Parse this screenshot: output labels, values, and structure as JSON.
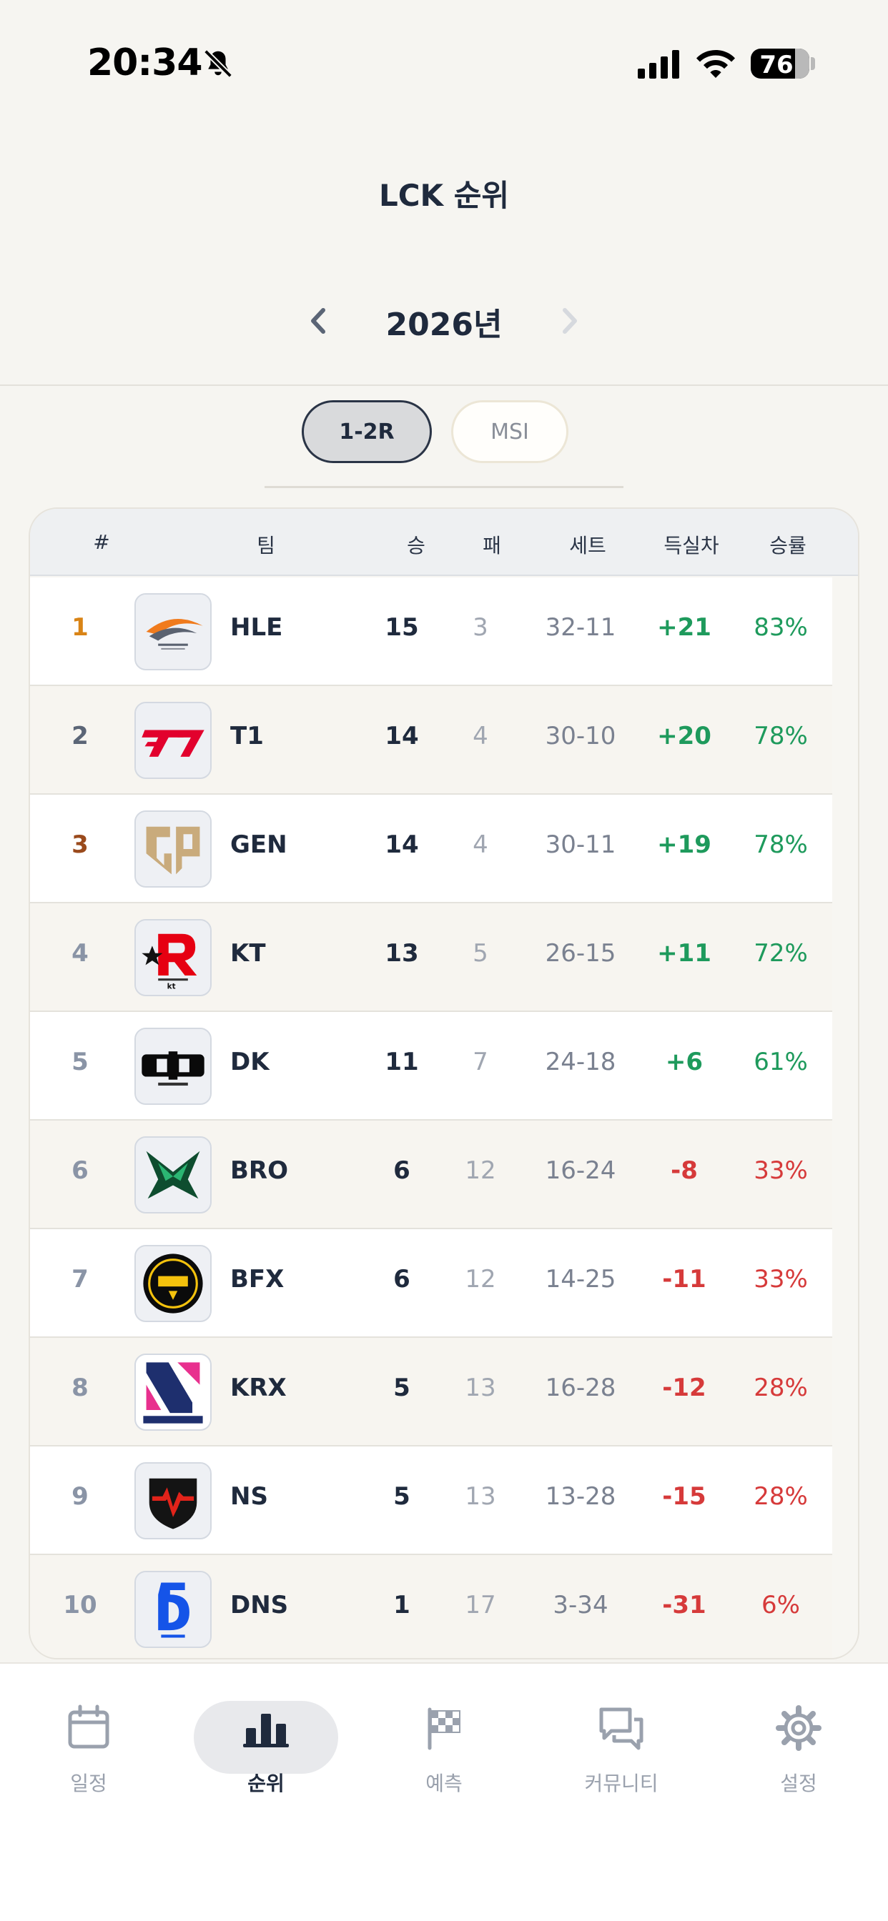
{
  "status_bar": {
    "time": "20:34",
    "battery": "76"
  },
  "header": {
    "title": "LCK 순위",
    "year": "2026년"
  },
  "segments": {
    "active": "1-2R",
    "inactive": "MSI"
  },
  "table": {
    "headers": {
      "rank": "#",
      "team": "팀",
      "win": "승",
      "loss": "패",
      "set": "세트",
      "diff": "득실차",
      "rate": "승률"
    },
    "rows": [
      {
        "rank": "1",
        "team": "HLE",
        "win": "15",
        "loss": "3",
        "set": "32-11",
        "diff": "+21",
        "rate": "83%",
        "rank_color": "#d98416",
        "logo": "hle-logo-icon"
      },
      {
        "rank": "2",
        "team": "T1",
        "win": "14",
        "loss": "4",
        "set": "30-10",
        "diff": "+20",
        "rate": "78%",
        "rank_color": "#5b6576",
        "logo": "t1-logo-icon"
      },
      {
        "rank": "3",
        "team": "GEN",
        "win": "14",
        "loss": "4",
        "set": "30-11",
        "diff": "+19",
        "rate": "78%",
        "rank_color": "#9a4a1c",
        "logo": "gen-logo-icon"
      },
      {
        "rank": "4",
        "team": "KT",
        "win": "13",
        "loss": "5",
        "set": "26-15",
        "diff": "+11",
        "rate": "72%",
        "rank_color": "#8a94a6",
        "logo": "kt-logo-icon"
      },
      {
        "rank": "5",
        "team": "DK",
        "win": "11",
        "loss": "7",
        "set": "24-18",
        "diff": "+6",
        "rate": "61%",
        "rank_color": "#8a94a6",
        "logo": "dk-logo-icon"
      },
      {
        "rank": "6",
        "team": "BRO",
        "win": "6",
        "loss": "12",
        "set": "16-24",
        "diff": "-8",
        "rate": "33%",
        "rank_color": "#8a94a6",
        "logo": "bro-logo-icon"
      },
      {
        "rank": "7",
        "team": "BFX",
        "win": "6",
        "loss": "12",
        "set": "14-25",
        "diff": "-11",
        "rate": "33%",
        "rank_color": "#8a94a6",
        "logo": "bfx-logo-icon"
      },
      {
        "rank": "8",
        "team": "KRX",
        "win": "5",
        "loss": "13",
        "set": "16-28",
        "diff": "-12",
        "rate": "28%",
        "rank_color": "#8a94a6",
        "logo": "krx-logo-icon"
      },
      {
        "rank": "9",
        "team": "NS",
        "win": "5",
        "loss": "13",
        "set": "13-28",
        "diff": "-15",
        "rate": "28%",
        "rank_color": "#8a94a6",
        "logo": "ns-logo-icon"
      },
      {
        "rank": "10",
        "team": "DNS",
        "win": "1",
        "loss": "17",
        "set": "3-34",
        "diff": "-31",
        "rate": "6%",
        "rank_color": "#8a94a6",
        "logo": "dns-logo-icon"
      }
    ]
  },
  "tabbar": {
    "items": [
      {
        "label": "일정",
        "icon": "calendar-icon"
      },
      {
        "label": "순위",
        "icon": "bar-chart-icon"
      },
      {
        "label": "예측",
        "icon": "checkered-flag-icon"
      },
      {
        "label": "커뮤니티",
        "icon": "chat-bubbles-icon"
      },
      {
        "label": "설정",
        "icon": "gear-icon"
      }
    ]
  },
  "colors": {
    "positive": "#1e9a5c",
    "negative": "#d63a3a",
    "text": "#1f2a3d",
    "muted": "#9aa1ad"
  }
}
